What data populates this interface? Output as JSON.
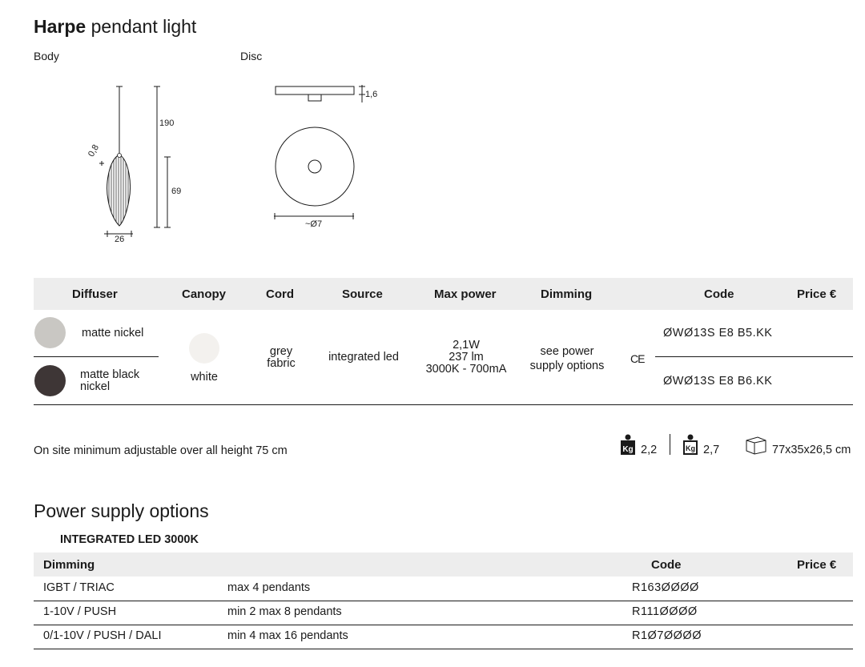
{
  "title": {
    "bold": "Harpe",
    "rest": "pendant light"
  },
  "drawings": {
    "body_label": "Body",
    "disc_label": "Disc",
    "body_dims": {
      "height_total": "190",
      "height_body": "69",
      "width": "26",
      "cord": "0,8"
    },
    "disc_dims": {
      "thickness": "1,6",
      "diameter": "~Ø7"
    }
  },
  "table": {
    "headers": [
      "Diffuser",
      "Canopy",
      "Cord",
      "Source",
      "Max power",
      "Dimming",
      "Code",
      "Price €"
    ],
    "diffusers": [
      {
        "label": "matte nickel",
        "color": "#c9c7c3"
      },
      {
        "label_line1": "matte black",
        "label_line2": "nickel",
        "color": "#3e3636"
      }
    ],
    "canopy": {
      "label": "white",
      "color": "#f3f1ee"
    },
    "cord": {
      "line1": "grey",
      "line2": "fabric"
    },
    "source": "integrated led",
    "max_power": {
      "line1": "2,1W",
      "line2": "237 lm",
      "line3": "3000K - 700mA"
    },
    "dimming": {
      "line1": "see power",
      "line2": "supply options"
    },
    "ce_mark": "CE",
    "codes": [
      "ØWØ13S E8 B5.KK",
      "ØWØ13S E8 B6.KK"
    ]
  },
  "note": "On site minimum adjustable over all height 75 cm",
  "shipping": {
    "net_weight": "2,2",
    "gross_weight": "2,7",
    "box_size": "77x35x26,5 cm",
    "weight_icon_text": "Kg"
  },
  "power_supply": {
    "title": "Power supply options",
    "subtitle": "INTEGRATED LED 3000K",
    "headers": {
      "dimming": "Dimming",
      "code": "Code",
      "price": "Price €"
    },
    "rows": [
      {
        "dimming": "IGBT / TRIAC",
        "pendants": "max 4 pendants",
        "code": "R163ØØØØ"
      },
      {
        "dimming": "1-10V / PUSH",
        "pendants": "min 2 max 8 pendants",
        "code": "R111ØØØØ"
      },
      {
        "dimming": "0/1-10V / PUSH / DALI",
        "pendants": "min 4 max 16 pendants",
        "code": "R1Ø7ØØØØ"
      }
    ]
  }
}
